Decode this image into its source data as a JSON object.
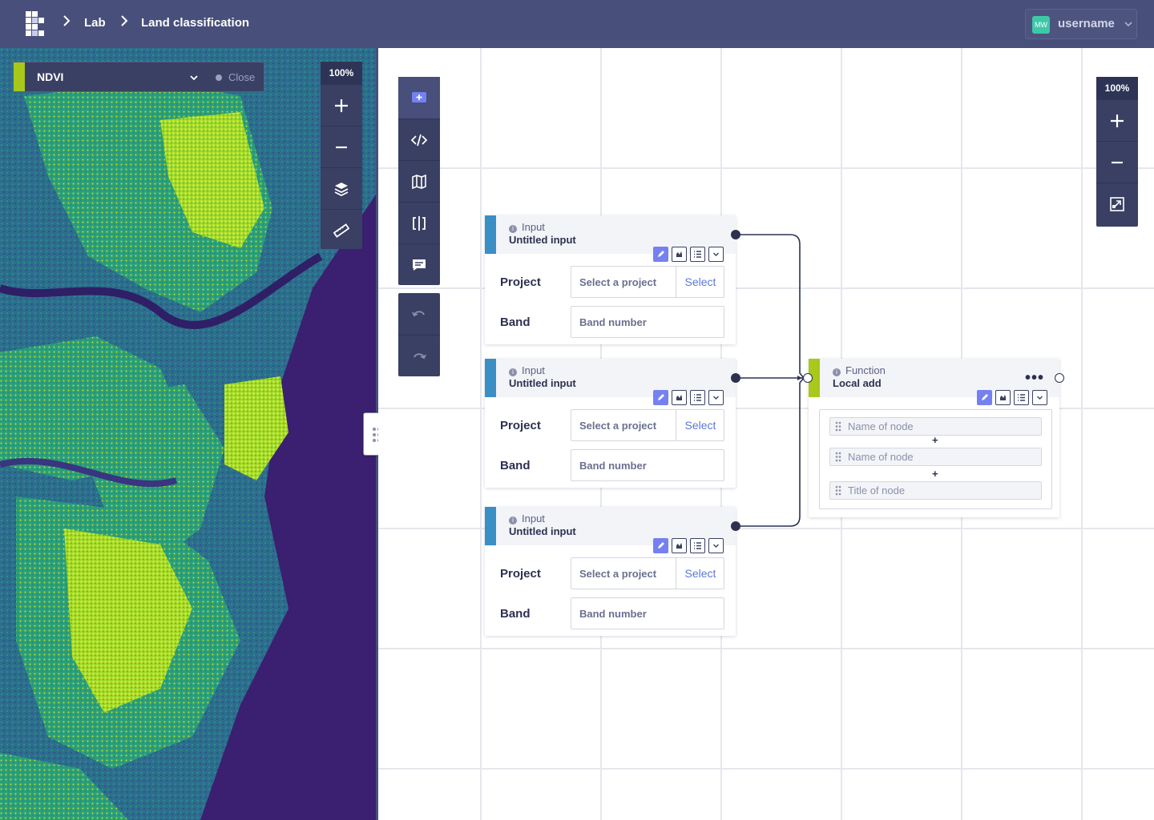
{
  "header": {
    "breadcrumb": [
      "Lab",
      "Land classification"
    ],
    "user": {
      "initials": "MW",
      "name": "username"
    }
  },
  "map": {
    "layer_name": "NDVI",
    "close_label": "Close",
    "zoom": "100%",
    "tools": [
      "plus-icon",
      "minus-icon",
      "layers-icon",
      "ruler-icon"
    ]
  },
  "lab": {
    "tools": [
      "add-node-icon",
      "code-icon",
      "map-icon",
      "split-view-icon",
      "comment-icon"
    ],
    "history": [
      "undo-icon",
      "redo-icon"
    ],
    "zoom": "100%",
    "zoom_tools": [
      "plus-icon",
      "minus-icon",
      "fit-icon"
    ]
  },
  "nodes": {
    "input_1": {
      "type": "Input",
      "title": "Untitled input",
      "project_label": "Project",
      "project_placeholder": "Select a project",
      "select_label": "Select",
      "band_label": "Band",
      "band_placeholder": "Band number"
    },
    "input_2": {
      "type": "Input",
      "title": "Untitled input",
      "project_label": "Project",
      "project_placeholder": "Select a project",
      "select_label": "Select",
      "band_label": "Band",
      "band_placeholder": "Band number"
    },
    "input_3": {
      "type": "Input",
      "title": "Untitled input",
      "project_label": "Project",
      "project_placeholder": "Select a project",
      "select_label": "Select",
      "band_label": "Band",
      "band_placeholder": "Band number"
    },
    "function": {
      "type": "Function",
      "title": "Local add",
      "more": "•••",
      "args": [
        "Name of node",
        "Name of node",
        "Title of node"
      ],
      "operator": "+"
    }
  },
  "colors": {
    "header": "#474f7a",
    "panel": "#3a4063",
    "input_accent": "#3a8fc4",
    "function_accent": "#a8c81a",
    "active_button": "#7581f0"
  }
}
